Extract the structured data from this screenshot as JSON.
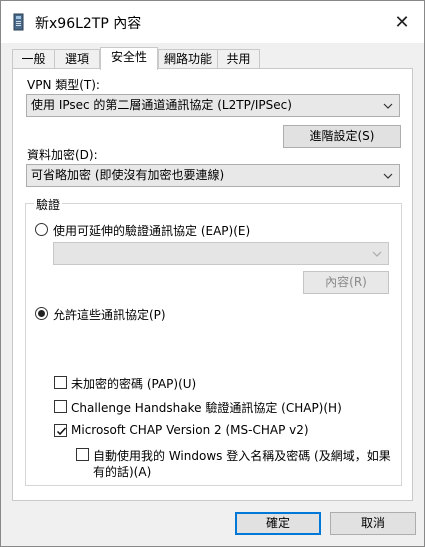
{
  "window": {
    "title": "新x96L2TP 內容",
    "close_label": "✕"
  },
  "tabs": [
    {
      "label": "一般",
      "active": false
    },
    {
      "label": "選項",
      "active": false
    },
    {
      "label": "安全性",
      "active": true
    },
    {
      "label": "網路功能",
      "active": false
    },
    {
      "label": "共用",
      "active": false
    }
  ],
  "vpn_type": {
    "label": "VPN 類型(T):",
    "value": "使用 IPsec 的第二層通道通訊協定 (L2TP/IPSec)",
    "advanced_button": "進階設定(S)"
  },
  "encryption": {
    "label": "資料加密(D):",
    "value": "可省略加密 (即使沒有加密也要連線)"
  },
  "auth": {
    "group_label": "驗證",
    "eap_radio": {
      "label": "使用可延伸的驗證通訊協定 (EAP)(E)",
      "checked": false
    },
    "eap_select_value": "",
    "properties_button": "內容(R)",
    "allow_radio": {
      "label": "允許這些通訊協定(P)",
      "checked": true
    },
    "protocols": [
      {
        "label": "未加密的密碼 (PAP)(U)",
        "checked": false
      },
      {
        "label": "Challenge Handshake 驗證通訊協定 (CHAP)(H)",
        "checked": false
      },
      {
        "label": "Microsoft CHAP Version 2 (MS-CHAP v2)",
        "checked": true
      }
    ],
    "auto_logon": {
      "label_line1": "自動使用我的 Windows 登入名稱及密碼 (及網域，如果",
      "label_line2": "有的話)(A)",
      "checked": false
    }
  },
  "footer": {
    "ok_label": "確定",
    "cancel_label": "取消"
  },
  "colors": {
    "accent": "#0078d7",
    "window_bg": "#f0f0f0",
    "panel_bg": "#ffffff"
  },
  "icons": {
    "title": "vpn-connection-icon",
    "close": "close-icon",
    "dropdown": "chevron-down-icon",
    "check": "checkmark-icon"
  }
}
